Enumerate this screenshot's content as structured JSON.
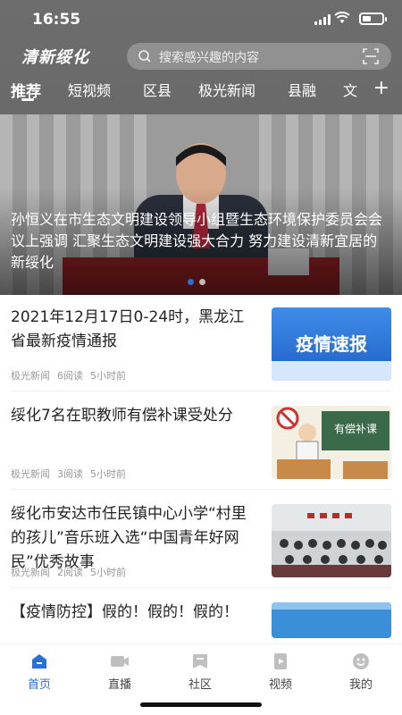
{
  "status": {
    "time": "16:55"
  },
  "header": {
    "logo": "清新绥化",
    "search_placeholder": "搜索感兴趣的内容"
  },
  "tabs": [
    "推荐",
    "短视频",
    "区县",
    "极光新闻",
    "县融",
    "文"
  ],
  "banner": {
    "caption": "孙恒义在市生态文明建设领导小组暨生态环境保护委员会会议上强调 汇聚生态文明建设强大合力 努力建设清新宜居的新绥化",
    "thumb_text": ""
  },
  "news": [
    {
      "title": "2021年12月17日0-24时，黑龙江省最新疫情通报",
      "source": "极光新闻",
      "reads": "6阅读",
      "time": "5小时前",
      "thumb_text": "疫情速报"
    },
    {
      "title": "绥化7名在职教师有偿补课受处分",
      "source": "极光新闻",
      "reads": "3阅读",
      "time": "5小时前",
      "thumb_text": "有偿补课"
    },
    {
      "title": "绥化市安达市任民镇中心小学“村里的孩儿”音乐班入选“中国青年好网民”优秀故事",
      "source": "极光新闻",
      "reads": "2阅读",
      "time": "5小时前",
      "thumb_text": ""
    },
    {
      "title": "【疫情防控】假的！假的！假的！",
      "source": "",
      "reads": "",
      "time": "",
      "thumb_text": ""
    }
  ],
  "bottom_nav": [
    {
      "label": "首页",
      "icon": "home-icon",
      "active": true
    },
    {
      "label": "直播",
      "icon": "camera-icon",
      "active": false
    },
    {
      "label": "社区",
      "icon": "community-icon",
      "active": false
    },
    {
      "label": "视频",
      "icon": "video-icon",
      "active": false
    },
    {
      "label": "我的",
      "icon": "profile-icon",
      "active": false
    }
  ],
  "colors": {
    "accent": "#2a6fd6",
    "header_bg": "#6d6d6d",
    "logo_green": "#d8f08a"
  }
}
